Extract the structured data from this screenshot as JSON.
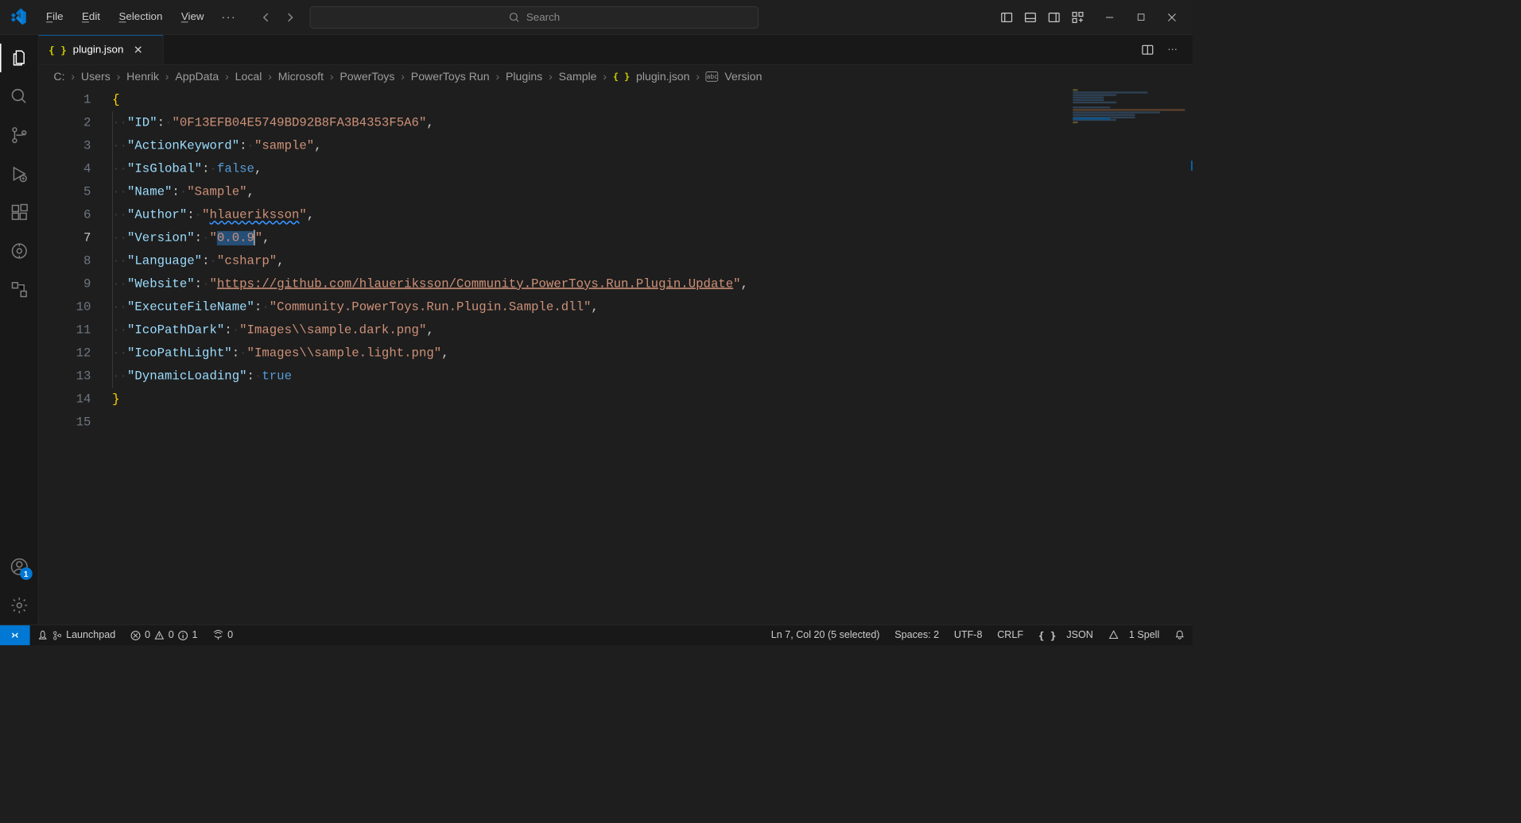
{
  "titlebar": {
    "menu": [
      "File",
      "Edit",
      "Selection",
      "View"
    ],
    "search_placeholder": "Search"
  },
  "activitybar": {
    "account_badge": "1"
  },
  "tab": {
    "filename": "plugin.json"
  },
  "breadcrumb": {
    "parts": [
      "C:",
      "Users",
      "Henrik",
      "AppData",
      "Local",
      "Microsoft",
      "PowerToys",
      "PowerToys Run",
      "Plugins",
      "Sample"
    ],
    "file": "plugin.json",
    "symbol": "Version"
  },
  "editor": {
    "current_line": 7,
    "line_count": 15,
    "json": {
      "ID": "0F13EFB04E5749BD92B8FA3B4353F5A6",
      "ActionKeyword": "sample",
      "IsGlobal": "false",
      "Name": "Sample",
      "Author": "hlaueriksson",
      "Version": "0.0.9",
      "Language": "csharp",
      "Website": "https://github.com/hlaueriksson/Community.PowerToys.Run.Plugin.Update",
      "ExecuteFileName": "Community.PowerToys.Run.Plugin.Sample.dll",
      "IcoPathDark": "Images\\\\sample.dark.png",
      "IcoPathLight": "Images\\\\sample.light.png",
      "DynamicLoading": "true"
    }
  },
  "statusbar": {
    "launchpad": "Launchpad",
    "errors": "0",
    "warnings": "0",
    "infos": "1",
    "ports": "0",
    "cursor": "Ln 7, Col 20 (5 selected)",
    "spaces": "Spaces: 2",
    "encoding": "UTF-8",
    "eol": "CRLF",
    "language": "JSON",
    "spell": "1 Spell"
  }
}
